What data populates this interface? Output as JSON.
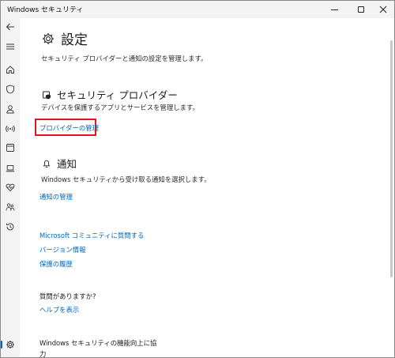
{
  "window": {
    "title": "Windows セキュリティ",
    "controls": [
      "minimize-icon",
      "maximize-icon",
      "close-icon"
    ]
  },
  "sidebar": {
    "items": [
      {
        "icon": "back-arrow-icon"
      },
      {
        "icon": "hamburger-menu-icon"
      },
      {
        "icon": "home-icon"
      },
      {
        "icon": "shield-icon"
      },
      {
        "icon": "person-icon"
      },
      {
        "icon": "wireless-network-icon"
      },
      {
        "icon": "app-browser-icon"
      },
      {
        "icon": "laptop-icon"
      },
      {
        "icon": "heart-pulse-icon"
      },
      {
        "icon": "family-icon"
      },
      {
        "icon": "history-icon"
      },
      {
        "icon": "gear-icon"
      }
    ]
  },
  "page": {
    "title": "設定",
    "description": "セキュリティ プロバイダーと通知の設定を管理します。"
  },
  "providers": {
    "heading": "セキュリティ プロバイダー",
    "description": "デバイスを保護するアプリとサービスを管理します。",
    "link": "プロバイダーの管理"
  },
  "notifications": {
    "heading": "通知",
    "description": "Windows セキュリティから受け取る通知を選択します。",
    "link": "通知の管理"
  },
  "links": {
    "community": "Microsoft コミュニティに質問する",
    "version": "バージョン情報",
    "history": "保護の履歴"
  },
  "help": {
    "question": "質問がありますか?",
    "link": "ヘルプを表示"
  },
  "improve": {
    "line1": "Windows セキュリティの機能向上に協",
    "line2": "力"
  },
  "colors": {
    "accent": "#0067c0",
    "highlight": "#e2171e",
    "sidebar_bg": "#f3f3f3"
  }
}
